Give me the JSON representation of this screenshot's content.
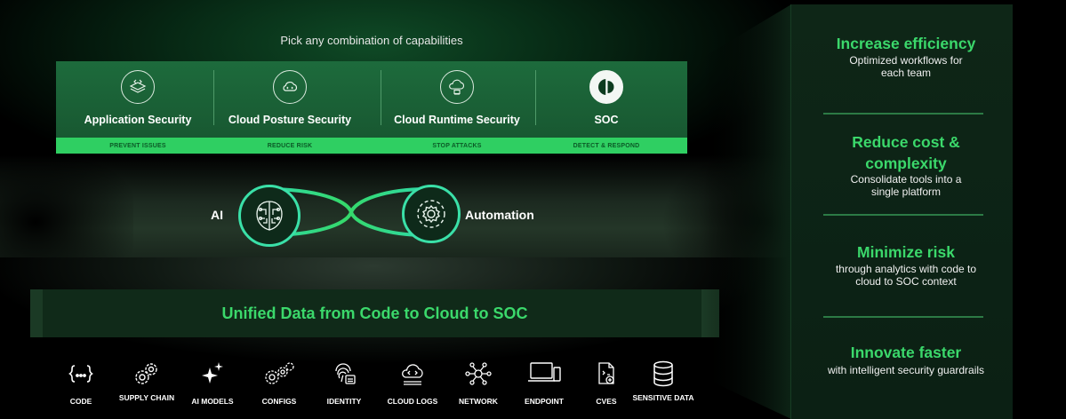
{
  "header": {
    "pick_label": "Pick any combination of capabilities"
  },
  "capabilities": [
    {
      "title": "Application Security",
      "subtitle": "PREVENT ISSUES",
      "icon": "code-layers-icon"
    },
    {
      "title": "Cloud Posture Security",
      "subtitle": "REDUCE RISK",
      "icon": "cloud-code-icon"
    },
    {
      "title": "Cloud Runtime Security",
      "subtitle": "STOP ATTACKS",
      "icon": "cloud-chip-icon"
    },
    {
      "title": "SOC",
      "subtitle": "DETECT & RESPOND",
      "icon": "soc-logo-icon"
    }
  ],
  "engine": {
    "ai_label": "AI",
    "automation_label": "Automation"
  },
  "unified": {
    "text": "Unified Data from Code to Cloud to SOC"
  },
  "sources": [
    {
      "label": "CODE",
      "icon": "braces-icon"
    },
    {
      "label": "SUPPLY CHAIN",
      "icon": "gears-icon"
    },
    {
      "label": "AI MODELS",
      "icon": "sparkle-icon"
    },
    {
      "label": "CONFIGS",
      "icon": "config-gears-icon"
    },
    {
      "label": "IDENTITY",
      "icon": "fingerprint-icon"
    },
    {
      "label": "CLOUD LOGS",
      "icon": "cloud-logs-icon"
    },
    {
      "label": "NETWORK",
      "icon": "network-icon"
    },
    {
      "label": "ENDPOINT",
      "icon": "laptop-icon"
    },
    {
      "label": "CVES",
      "icon": "document-bug-icon"
    },
    {
      "label": "SENSITIVE DATA",
      "icon": "database-icon"
    }
  ],
  "benefits": [
    {
      "title": "Increase efficiency",
      "text": "Optimized workflows for each team"
    },
    {
      "title": "Reduce cost & complexity",
      "text": "Consolidate tools into a single platform"
    },
    {
      "title": "Minimize risk",
      "text": "through analytics with code to cloud to SOC context"
    },
    {
      "title": "Innovate faster",
      "text": "with intelligent security guardrails"
    }
  ],
  "colors": {
    "accent": "#3bd86b",
    "panel": "#1d6b3c",
    "strip": "#2fcf62",
    "background": "#000000"
  }
}
